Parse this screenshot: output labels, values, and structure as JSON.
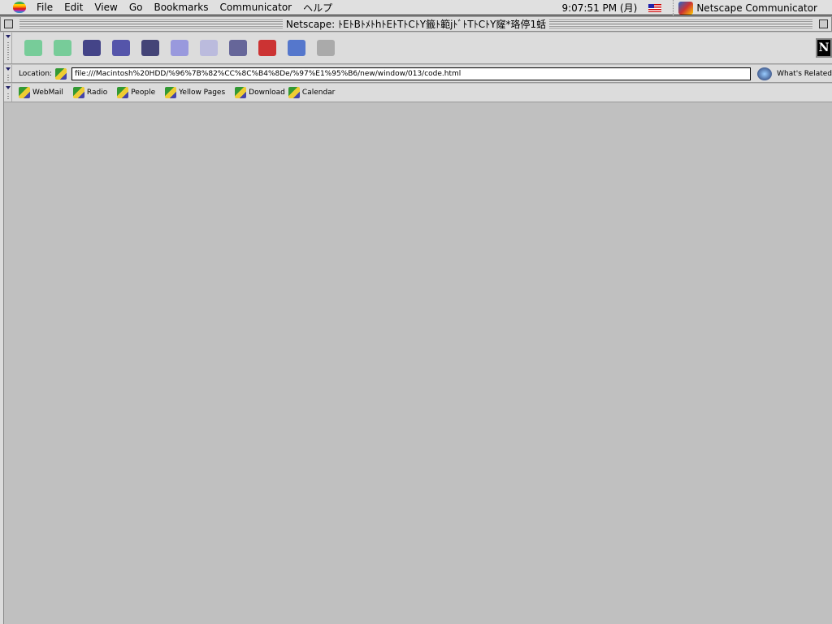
{
  "menubar": {
    "items": [
      "File",
      "Edit",
      "View",
      "Go",
      "Bookmarks",
      "Communicator",
      "ヘルプ"
    ],
    "clock": "9:07:51 PM (月)",
    "app": "Netscape Communicator"
  },
  "window": {
    "title": "Netscape: ﾄEﾄBﾄﾒﾄhﾄEﾄTﾄCﾄY籤ﾄ範jﾄﾞﾄTﾄCﾄY窿*珞停1蛞"
  },
  "toolbar": {
    "buttons": [
      {
        "icon": "back-icon",
        "color": "#7c9"
      },
      {
        "icon": "forward-icon",
        "color": "#7c9"
      },
      {
        "icon": "reload-icon",
        "color": "#448"
      },
      {
        "icon": "home-icon",
        "color": "#55a"
      },
      {
        "icon": "search-icon",
        "color": "#447"
      },
      {
        "icon": "my-netscape-icon",
        "color": "#99d"
      },
      {
        "icon": "images-icon",
        "color": "#bbd"
      },
      {
        "icon": "print-icon",
        "color": "#669"
      },
      {
        "icon": "security-icon",
        "color": "#c33"
      },
      {
        "icon": "shop-icon",
        "color": "#57c"
      },
      {
        "icon": "stop-icon",
        "color": "#aaa"
      }
    ]
  },
  "location": {
    "label": "Location:",
    "url": "file:///Macintosh%20HDD/%96%7B%82%CC%8C%B4%8De/%97%E1%95%B6/new/window/013/code.html",
    "related": "What's Related"
  },
  "bookmarks": [
    "WebMail",
    "Radio",
    "People",
    "Yellow Pages",
    "Download",
    "Calendar"
  ],
  "logo": "N"
}
